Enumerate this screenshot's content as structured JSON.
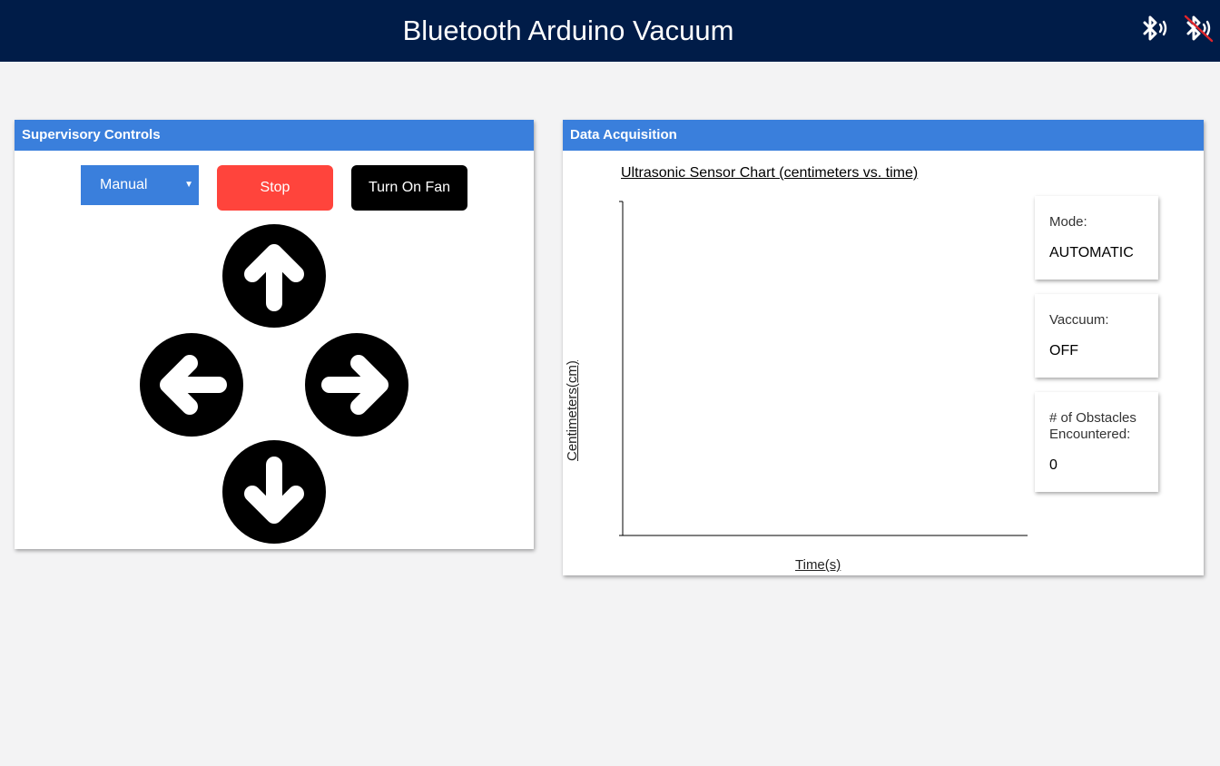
{
  "header": {
    "title": "Bluetooth Arduino Vacuum",
    "icons": [
      "bluetooth-connect-icon",
      "bluetooth-disconnect-icon"
    ],
    "background": "#001c48"
  },
  "supervisory": {
    "title": "Supervisory Controls",
    "mode_value": "Manual",
    "stop_label": "Stop",
    "fan_label": "Turn On Fan",
    "arrows": [
      "arrow-up-icon",
      "arrow-left-icon",
      "arrow-right-icon",
      "arrow-down-icon"
    ]
  },
  "data_acquisition": {
    "title": "Data Acquisition",
    "chart_data": {
      "type": "line",
      "title": "Ultrasonic Sensor Chart (centimeters vs. time)",
      "xlabel": "Time(s)",
      "ylabel": "Centimeters(cm)",
      "series": []
    },
    "stats": {
      "mode_label": "Mode:",
      "mode_value": "AUTOMATIC",
      "vacuum_label": "Vaccuum:",
      "vacuum_value": "OFF",
      "obstacles_label": "# of Obstacles Encountered:",
      "obstacles_value": "0"
    }
  },
  "colors": {
    "accent": "#3a7fdc",
    "stop": "#ff443c",
    "fan": "#000000",
    "disconnect_slash": "#e0252b"
  }
}
